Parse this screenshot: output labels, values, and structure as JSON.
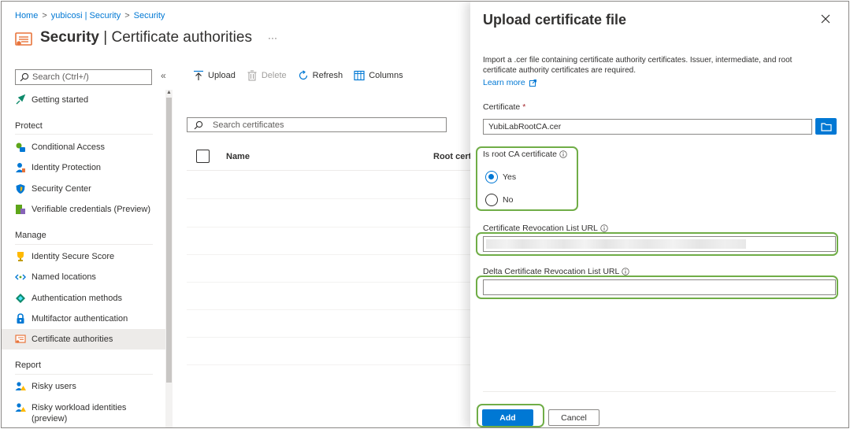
{
  "breadcrumb": {
    "home": "Home",
    "tenant": "yubicosi | Security",
    "current": "Security"
  },
  "page": {
    "title_bold": "Security",
    "title_rest": "Certificate authorities",
    "more": "···"
  },
  "sidebar": {
    "search_placeholder": "Search (Ctrl+/)",
    "collapse": "«",
    "top_item": "Getting started",
    "sections": [
      {
        "head": "Protect",
        "items": [
          "Conditional Access",
          "Identity Protection",
          "Security Center",
          "Verifiable credentials (Preview)"
        ]
      },
      {
        "head": "Manage",
        "items": [
          "Identity Secure Score",
          "Named locations",
          "Authentication methods",
          "Multifactor authentication",
          "Certificate authorities"
        ]
      },
      {
        "head": "Report",
        "items": [
          "Risky users",
          "Risky workload identities (preview)"
        ]
      }
    ],
    "selected": "Certificate authorities"
  },
  "toolbar": {
    "upload": "Upload",
    "delete": "Delete",
    "refresh": "Refresh",
    "columns": "Columns"
  },
  "list": {
    "search_placeholder": "Search certificates",
    "col_name": "Name",
    "col_root": "Root cert"
  },
  "panel": {
    "title": "Upload certificate file",
    "description": "Import a .cer file containing certificate authority certificates. Issuer, intermediate, and root certificate authority certificates are required.",
    "learn_more": "Learn more",
    "certificate_label": "Certificate",
    "required_mark": "*",
    "certificate_value": "YubiLabRootCA.cer",
    "root_label": "Is root CA certificate",
    "yes": "Yes",
    "no": "No",
    "crl_label": "Certificate Revocation List URL",
    "delta_crl_label": "Delta Certificate Revocation List URL",
    "delta_crl_value": "",
    "add": "Add",
    "cancel": "Cancel"
  },
  "colors": {
    "accent": "#0078d4",
    "highlight": "#70ad47",
    "selected_bg": "#edebe9"
  }
}
